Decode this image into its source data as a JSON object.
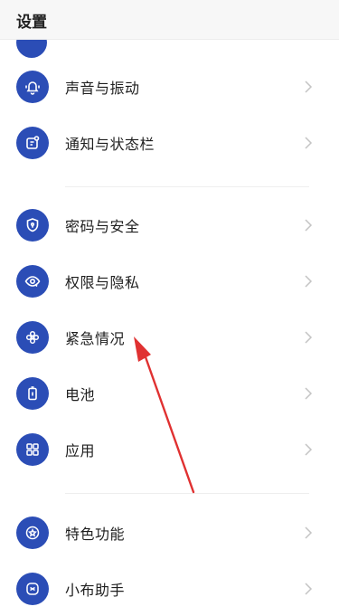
{
  "header": {
    "title": "设置"
  },
  "items": [
    {
      "label": "声音与振动",
      "icon": "bell-icon"
    },
    {
      "label": "通知与状态栏",
      "icon": "notification-icon"
    },
    {
      "label": "密码与安全",
      "icon": "shield-lock-icon"
    },
    {
      "label": "权限与隐私",
      "icon": "privacy-eye-icon"
    },
    {
      "label": "紧急情况",
      "icon": "emergency-icon"
    },
    {
      "label": "电池",
      "icon": "battery-icon"
    },
    {
      "label": "应用",
      "icon": "apps-grid-icon"
    },
    {
      "label": "特色功能",
      "icon": "star-circle-icon"
    },
    {
      "label": "小布助手",
      "icon": "assistant-icon"
    }
  ],
  "colors": {
    "icon_bg": "#2b4db6",
    "annotation_arrow": "#e03131"
  }
}
